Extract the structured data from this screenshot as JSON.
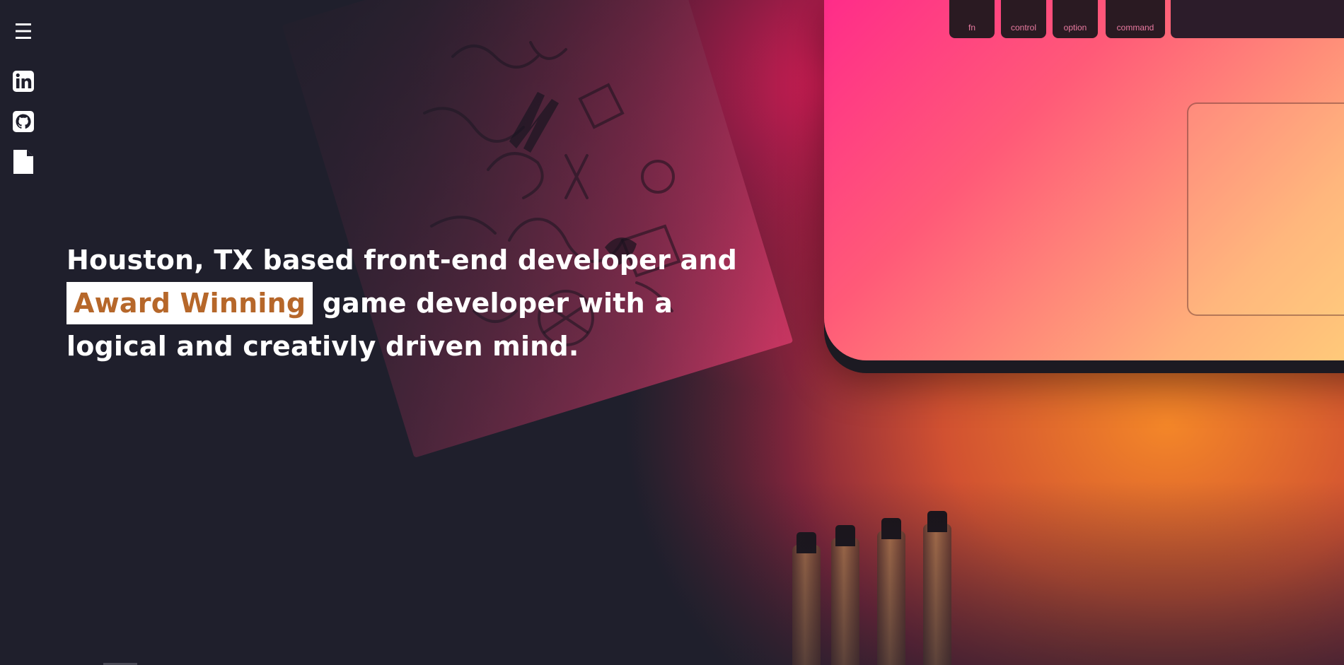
{
  "sidebar": {
    "menu_icon": "hamburger-menu-icon",
    "menu_glyph": "☰",
    "links": [
      {
        "name": "linkedin",
        "icon": "linkedin-icon"
      },
      {
        "name": "github",
        "icon": "github-icon"
      },
      {
        "name": "resume",
        "icon": "document-icon"
      }
    ]
  },
  "hero": {
    "line1": "Houston, TX based front-end developer and",
    "highlight": "Award Winning",
    "line2_rest": " game developer with a",
    "line3": "logical and creativly driven mind."
  },
  "background": {
    "keys": [
      "fn",
      "control",
      "option",
      "command"
    ]
  },
  "colors": {
    "background": "#1f1f2c",
    "text": "#ffffff",
    "highlight_bg": "#ffffff",
    "highlight_text": "#b6672a",
    "accent_pink": "#ff2a8a",
    "accent_orange": "#ff8c28"
  }
}
